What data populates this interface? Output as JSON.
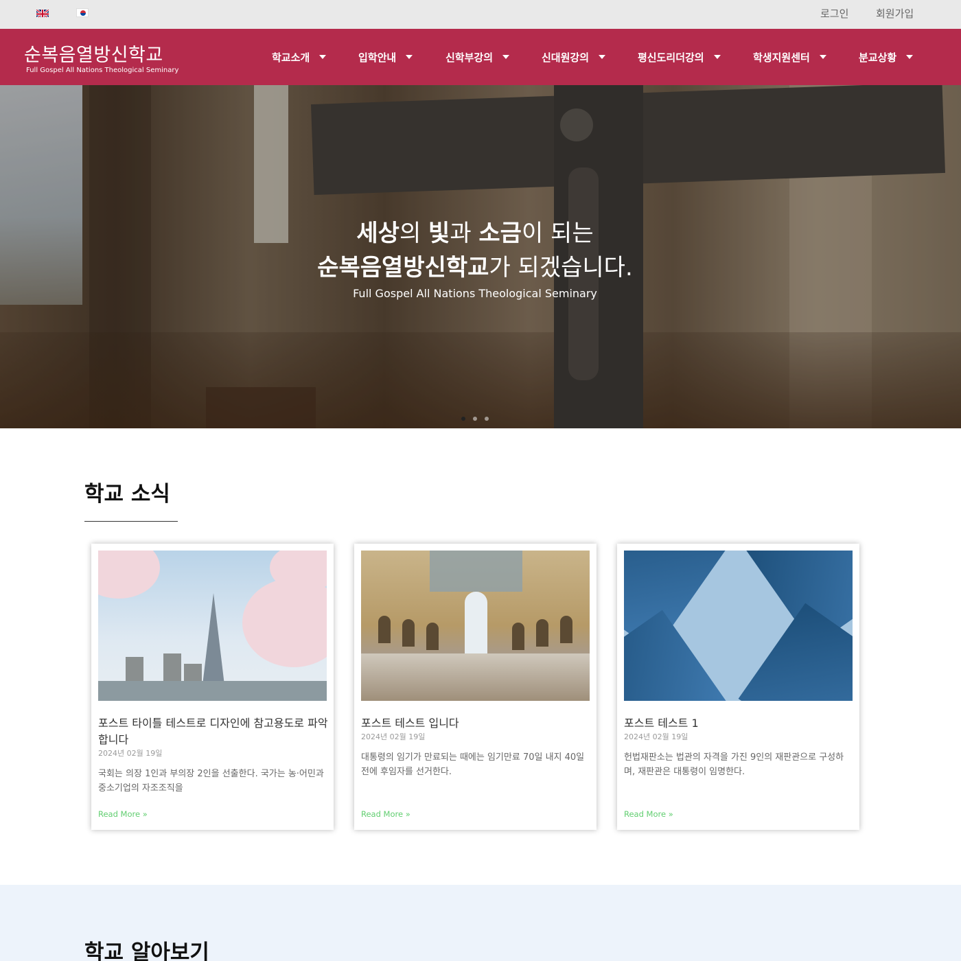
{
  "topbar": {
    "languages": [
      {
        "name": "uk-flag-icon",
        "lang": "English"
      },
      {
        "name": "korea-flag-icon",
        "lang": "Korean"
      }
    ],
    "login": "로그인",
    "signup": "회원가입"
  },
  "header": {
    "logo_title": "순복음열방신학교",
    "logo_subtitle": "Full Gospel All Nations Theological Seminary",
    "brand_color": "#b42b4c",
    "nav": [
      {
        "label": "학교소개"
      },
      {
        "label": "입학안내"
      },
      {
        "label": "신학부강의"
      },
      {
        "label": "신대원강의"
      },
      {
        "label": "평신도리더강의"
      },
      {
        "label": "학생지원센터"
      },
      {
        "label": "분교상황"
      }
    ]
  },
  "hero": {
    "line1_b1": "세상",
    "line1_t1": "의 ",
    "line1_b2": "빛",
    "line1_t2": "과 ",
    "line1_b3": "소금",
    "line1_t3": "이 되는",
    "line2_b1": "순복음열방신학교",
    "line2_t1": "가 되겠습니다.",
    "subtitle": "Full Gospel All Nations Theological Seminary",
    "slide_count": 3,
    "active_slide": 1
  },
  "news": {
    "title": "학교 소식",
    "posts": [
      {
        "title": "포스트 타이틀 테스트로 디자인에 참고용도로 파악합니다",
        "date": "2024년 02월 19일",
        "excerpt": "국회는 의장 1인과 부의장 2인을 선출한다. 국가는 농·어민과 중소기업의 자조조직을",
        "read_more": "Read More »"
      },
      {
        "title": "포스트 테스트 입니다",
        "date": "2024년 02월 19일",
        "excerpt": "대통령의 임기가 만료되는 때에는 임기만료 70일 내지 40일 전에 후임자를 선거한다.",
        "read_more": "Read More »"
      },
      {
        "title": "포스트 테스트 1",
        "date": "2024년 02월 19일",
        "excerpt": "헌법재판소는 법관의 자격을 가진 9인의 재판관으로 구성하며, 재판관은 대통령이 임명한다.",
        "read_more": "Read More »"
      }
    ],
    "link_color": "#61ce70"
  },
  "about": {
    "title": "학교 알아보기"
  }
}
